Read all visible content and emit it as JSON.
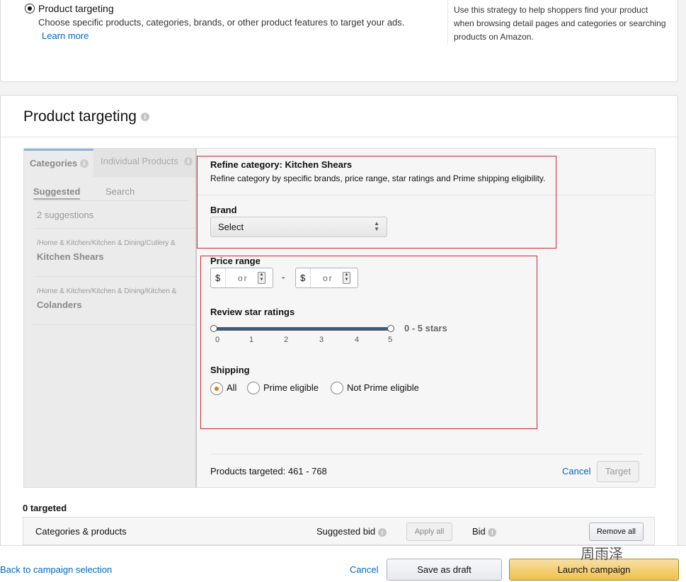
{
  "strategy": {
    "option_label": "Product targeting",
    "option_desc": "Choose specific products, categories, brands, or other product features to target your ads.",
    "learn_more": "Learn more",
    "help_text": "Use this strategy to help shoppers find your product when browsing detail pages and categories or searching products on Amazon."
  },
  "section": {
    "title": "Product targeting",
    "info_glyph": "i"
  },
  "tabs": {
    "categories": "Categories",
    "individual": "Individual Products"
  },
  "subtabs": {
    "suggested": "Suggested",
    "search": "Search"
  },
  "suggestions": {
    "count_label": "2 suggestions",
    "items": [
      {
        "path": "/Home & Kitchen/Kitchen & Dining/Cutlery &",
        "name": "Kitchen Shears"
      },
      {
        "path": "/Home & Kitchen/Kitchen & Dining/Kitchen &",
        "name": "Colanders"
      }
    ]
  },
  "refine": {
    "title": "Refine category: Kitchen Shears",
    "desc": "Refine category by specific brands, price range, star ratings and Prime shipping eligibility.",
    "brand_label": "Brand",
    "brand_select": "Select",
    "price_label": "Price range",
    "currency": "$",
    "price_min_placeholder": "or",
    "price_max_placeholder": "or",
    "dash": "-",
    "rating_label": "Review star ratings",
    "rating_ticks": [
      "0",
      "1",
      "2",
      "3",
      "4",
      "5"
    ],
    "rating_value_text": "0 - 5 stars",
    "rating_min": 0,
    "rating_max": 5,
    "shipping_label": "Shipping",
    "shipping_options": [
      "All",
      "Prime eligible",
      "Not Prime eligible"
    ],
    "shipping_selected": "All",
    "products_targeted": "Products targeted: 461 - 768",
    "cancel": "Cancel",
    "target": "Target"
  },
  "targeted": {
    "count_label": "0 targeted",
    "col_categories": "Categories & products",
    "col_suggested_bid": "Suggested bid",
    "apply_all": "Apply all",
    "col_bid": "Bid",
    "remove_all": "Remove all"
  },
  "footer": {
    "back": "Back to campaign selection",
    "cancel": "Cancel",
    "save_draft": "Save as draft",
    "launch": "Launch campaign"
  },
  "watermark": "周雨泽",
  "colors": {
    "link": "#0066c0",
    "accent_orange": "#e47911",
    "launch_yellow": "#f0c14b",
    "annotation_red": "#d3262e"
  }
}
